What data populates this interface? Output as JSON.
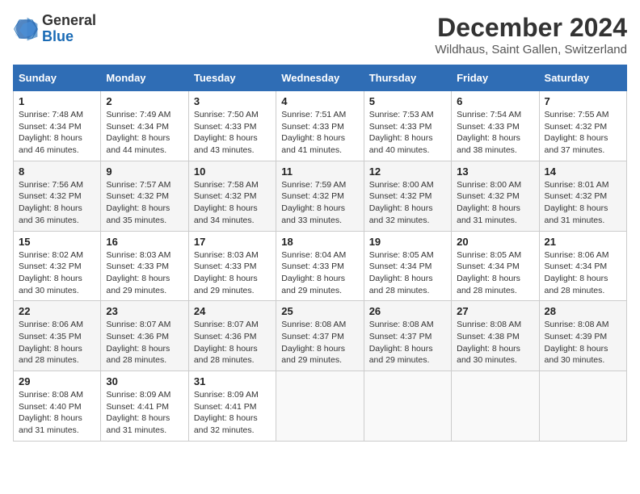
{
  "logo": {
    "general": "General",
    "blue": "Blue"
  },
  "title": "December 2024",
  "location": "Wildhaus, Saint Gallen, Switzerland",
  "days_of_week": [
    "Sunday",
    "Monday",
    "Tuesday",
    "Wednesday",
    "Thursday",
    "Friday",
    "Saturday"
  ],
  "weeks": [
    [
      {
        "day": "1",
        "sunrise": "Sunrise: 7:48 AM",
        "sunset": "Sunset: 4:34 PM",
        "daylight": "Daylight: 8 hours and 46 minutes."
      },
      {
        "day": "2",
        "sunrise": "Sunrise: 7:49 AM",
        "sunset": "Sunset: 4:34 PM",
        "daylight": "Daylight: 8 hours and 44 minutes."
      },
      {
        "day": "3",
        "sunrise": "Sunrise: 7:50 AM",
        "sunset": "Sunset: 4:33 PM",
        "daylight": "Daylight: 8 hours and 43 minutes."
      },
      {
        "day": "4",
        "sunrise": "Sunrise: 7:51 AM",
        "sunset": "Sunset: 4:33 PM",
        "daylight": "Daylight: 8 hours and 41 minutes."
      },
      {
        "day": "5",
        "sunrise": "Sunrise: 7:53 AM",
        "sunset": "Sunset: 4:33 PM",
        "daylight": "Daylight: 8 hours and 40 minutes."
      },
      {
        "day": "6",
        "sunrise": "Sunrise: 7:54 AM",
        "sunset": "Sunset: 4:33 PM",
        "daylight": "Daylight: 8 hours and 38 minutes."
      },
      {
        "day": "7",
        "sunrise": "Sunrise: 7:55 AM",
        "sunset": "Sunset: 4:32 PM",
        "daylight": "Daylight: 8 hours and 37 minutes."
      }
    ],
    [
      {
        "day": "8",
        "sunrise": "Sunrise: 7:56 AM",
        "sunset": "Sunset: 4:32 PM",
        "daylight": "Daylight: 8 hours and 36 minutes."
      },
      {
        "day": "9",
        "sunrise": "Sunrise: 7:57 AM",
        "sunset": "Sunset: 4:32 PM",
        "daylight": "Daylight: 8 hours and 35 minutes."
      },
      {
        "day": "10",
        "sunrise": "Sunrise: 7:58 AM",
        "sunset": "Sunset: 4:32 PM",
        "daylight": "Daylight: 8 hours and 34 minutes."
      },
      {
        "day": "11",
        "sunrise": "Sunrise: 7:59 AM",
        "sunset": "Sunset: 4:32 PM",
        "daylight": "Daylight: 8 hours and 33 minutes."
      },
      {
        "day": "12",
        "sunrise": "Sunrise: 8:00 AM",
        "sunset": "Sunset: 4:32 PM",
        "daylight": "Daylight: 8 hours and 32 minutes."
      },
      {
        "day": "13",
        "sunrise": "Sunrise: 8:00 AM",
        "sunset": "Sunset: 4:32 PM",
        "daylight": "Daylight: 8 hours and 31 minutes."
      },
      {
        "day": "14",
        "sunrise": "Sunrise: 8:01 AM",
        "sunset": "Sunset: 4:32 PM",
        "daylight": "Daylight: 8 hours and 31 minutes."
      }
    ],
    [
      {
        "day": "15",
        "sunrise": "Sunrise: 8:02 AM",
        "sunset": "Sunset: 4:32 PM",
        "daylight": "Daylight: 8 hours and 30 minutes."
      },
      {
        "day": "16",
        "sunrise": "Sunrise: 8:03 AM",
        "sunset": "Sunset: 4:33 PM",
        "daylight": "Daylight: 8 hours and 29 minutes."
      },
      {
        "day": "17",
        "sunrise": "Sunrise: 8:03 AM",
        "sunset": "Sunset: 4:33 PM",
        "daylight": "Daylight: 8 hours and 29 minutes."
      },
      {
        "day": "18",
        "sunrise": "Sunrise: 8:04 AM",
        "sunset": "Sunset: 4:33 PM",
        "daylight": "Daylight: 8 hours and 29 minutes."
      },
      {
        "day": "19",
        "sunrise": "Sunrise: 8:05 AM",
        "sunset": "Sunset: 4:34 PM",
        "daylight": "Daylight: 8 hours and 28 minutes."
      },
      {
        "day": "20",
        "sunrise": "Sunrise: 8:05 AM",
        "sunset": "Sunset: 4:34 PM",
        "daylight": "Daylight: 8 hours and 28 minutes."
      },
      {
        "day": "21",
        "sunrise": "Sunrise: 8:06 AM",
        "sunset": "Sunset: 4:34 PM",
        "daylight": "Daylight: 8 hours and 28 minutes."
      }
    ],
    [
      {
        "day": "22",
        "sunrise": "Sunrise: 8:06 AM",
        "sunset": "Sunset: 4:35 PM",
        "daylight": "Daylight: 8 hours and 28 minutes."
      },
      {
        "day": "23",
        "sunrise": "Sunrise: 8:07 AM",
        "sunset": "Sunset: 4:36 PM",
        "daylight": "Daylight: 8 hours and 28 minutes."
      },
      {
        "day": "24",
        "sunrise": "Sunrise: 8:07 AM",
        "sunset": "Sunset: 4:36 PM",
        "daylight": "Daylight: 8 hours and 28 minutes."
      },
      {
        "day": "25",
        "sunrise": "Sunrise: 8:08 AM",
        "sunset": "Sunset: 4:37 PM",
        "daylight": "Daylight: 8 hours and 29 minutes."
      },
      {
        "day": "26",
        "sunrise": "Sunrise: 8:08 AM",
        "sunset": "Sunset: 4:37 PM",
        "daylight": "Daylight: 8 hours and 29 minutes."
      },
      {
        "day": "27",
        "sunrise": "Sunrise: 8:08 AM",
        "sunset": "Sunset: 4:38 PM",
        "daylight": "Daylight: 8 hours and 30 minutes."
      },
      {
        "day": "28",
        "sunrise": "Sunrise: 8:08 AM",
        "sunset": "Sunset: 4:39 PM",
        "daylight": "Daylight: 8 hours and 30 minutes."
      }
    ],
    [
      {
        "day": "29",
        "sunrise": "Sunrise: 8:08 AM",
        "sunset": "Sunset: 4:40 PM",
        "daylight": "Daylight: 8 hours and 31 minutes."
      },
      {
        "day": "30",
        "sunrise": "Sunrise: 8:09 AM",
        "sunset": "Sunset: 4:41 PM",
        "daylight": "Daylight: 8 hours and 31 minutes."
      },
      {
        "day": "31",
        "sunrise": "Sunrise: 8:09 AM",
        "sunset": "Sunset: 4:41 PM",
        "daylight": "Daylight: 8 hours and 32 minutes."
      },
      null,
      null,
      null,
      null
    ]
  ]
}
